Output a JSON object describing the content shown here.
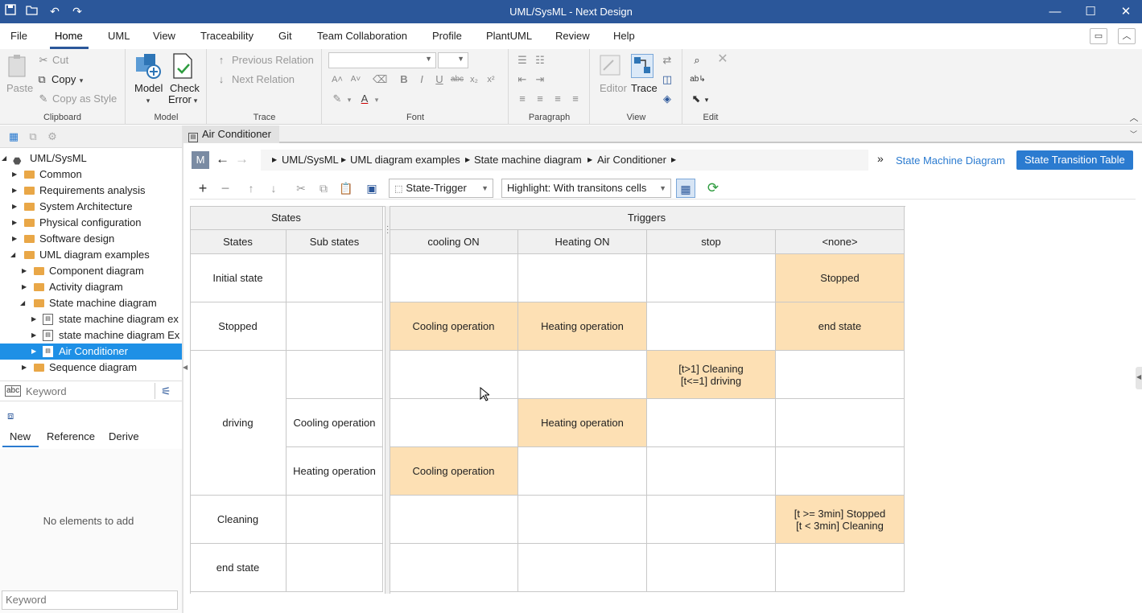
{
  "window": {
    "title": "UML/SysML - Next Design",
    "controls": {
      "minimize": "—",
      "maximize": "☐",
      "close": "✕"
    }
  },
  "quick_access": [
    "save-icon",
    "open-icon",
    "undo-icon",
    "redo-icon"
  ],
  "menu": {
    "items": [
      "File",
      "Home",
      "UML",
      "View",
      "Traceability",
      "Git",
      "Team Collaboration",
      "Profile",
      "PlantUML",
      "Review",
      "Help"
    ],
    "active": "Home"
  },
  "ribbon": {
    "clipboard": {
      "label": "Clipboard",
      "paste": "Paste",
      "cut": "Cut",
      "copy": "Copy",
      "copy_as_style": "Copy as Style"
    },
    "model": {
      "label": "Model",
      "model": "Model",
      "check_error_1": "Check",
      "check_error_2": "Error"
    },
    "trace": {
      "label": "Trace",
      "previous": "Previous Relation",
      "next": "Next Relation"
    },
    "font": {
      "label": "Font"
    },
    "paragraph": {
      "label": "Paragraph"
    },
    "view": {
      "label": "View",
      "editor": "Editor",
      "trace": "Trace"
    },
    "edit": {
      "label": "Edit"
    }
  },
  "tree": {
    "items": [
      {
        "label": "UML/SysML",
        "level": 0,
        "expanded": true,
        "kind": "root"
      },
      {
        "label": "Common",
        "level": 1,
        "expanded": false,
        "kind": "folder"
      },
      {
        "label": "Requirements analysis",
        "level": 1,
        "expanded": false,
        "kind": "folder"
      },
      {
        "label": "System Architecture",
        "level": 1,
        "expanded": false,
        "kind": "folder"
      },
      {
        "label": "Physical configuration",
        "level": 1,
        "expanded": false,
        "kind": "folder"
      },
      {
        "label": "Software design",
        "level": 1,
        "expanded": false,
        "kind": "folder"
      },
      {
        "label": "UML diagram examples",
        "level": 1,
        "expanded": true,
        "kind": "folder"
      },
      {
        "label": "Component diagram",
        "level": 2,
        "expanded": false,
        "kind": "folder"
      },
      {
        "label": "Activity diagram",
        "level": 2,
        "expanded": false,
        "kind": "folder"
      },
      {
        "label": "State machine diagram",
        "level": 2,
        "expanded": true,
        "kind": "folder"
      },
      {
        "label": "state machine diagram ex",
        "level": 3,
        "expanded": false,
        "kind": "model"
      },
      {
        "label": "state machine diagram Ex",
        "level": 3,
        "expanded": false,
        "kind": "model"
      },
      {
        "label": "Air Conditioner",
        "level": 3,
        "expanded": false,
        "kind": "model",
        "selected": true
      },
      {
        "label": "Sequence diagram",
        "level": 2,
        "expanded": false,
        "kind": "folder"
      }
    ]
  },
  "search": {
    "placeholder": "Keyword"
  },
  "lower_panel": {
    "tabs": [
      "New",
      "Reference",
      "Derive"
    ],
    "active_tab": "New",
    "empty_text": "No elements to add",
    "keyword_placeholder": "Keyword"
  },
  "document": {
    "tab": "Air Conditioner",
    "badge": "M",
    "breadcrumb": [
      "UML/SysML",
      "UML diagram examples",
      "State machine diagram",
      "Air Conditioner"
    ],
    "overflow": "»",
    "view_link": "State Machine Diagram",
    "view_button": "State Transition Table"
  },
  "table_toolbar": {
    "mode": "State-Trigger",
    "highlight": "Highlight: With transitons cells"
  },
  "colors": {
    "accent": "#2b579a",
    "highlight_cell": "#fde0b4",
    "selected": "#1e90e6",
    "link": "#2b7bd0"
  },
  "table": {
    "group_states": "States",
    "group_triggers": "Triggers",
    "col_states": "States",
    "col_substates": "Sub states",
    "triggers": [
      "cooling ON",
      "Heating ON",
      "stop",
      "<none>"
    ],
    "rows": [
      {
        "state": "Initial state",
        "sub": "",
        "cells": [
          "",
          "",
          "",
          "Stopped"
        ]
      },
      {
        "state": "Stopped",
        "sub": "",
        "cells": [
          "Cooling operation",
          "Heating operation",
          "",
          "end state"
        ]
      },
      {
        "state": "driving",
        "sub": "",
        "cells": [
          "",
          "",
          "[t>1] Cleaning\n[t<=1] driving",
          ""
        ]
      },
      {
        "state": "",
        "sub": "Cooling operation",
        "cells": [
          "",
          "Heating operation",
          "",
          ""
        ]
      },
      {
        "state": "",
        "sub": "Heating operation",
        "cells": [
          "Cooling operation",
          "",
          "",
          ""
        ]
      },
      {
        "state": "Cleaning",
        "sub": "",
        "cells": [
          "",
          "",
          "",
          "[t >= 3min] Stopped\n[t < 3min] Cleaning"
        ]
      },
      {
        "state": "end state",
        "sub": "",
        "cells": [
          "",
          "",
          "",
          ""
        ]
      }
    ]
  }
}
